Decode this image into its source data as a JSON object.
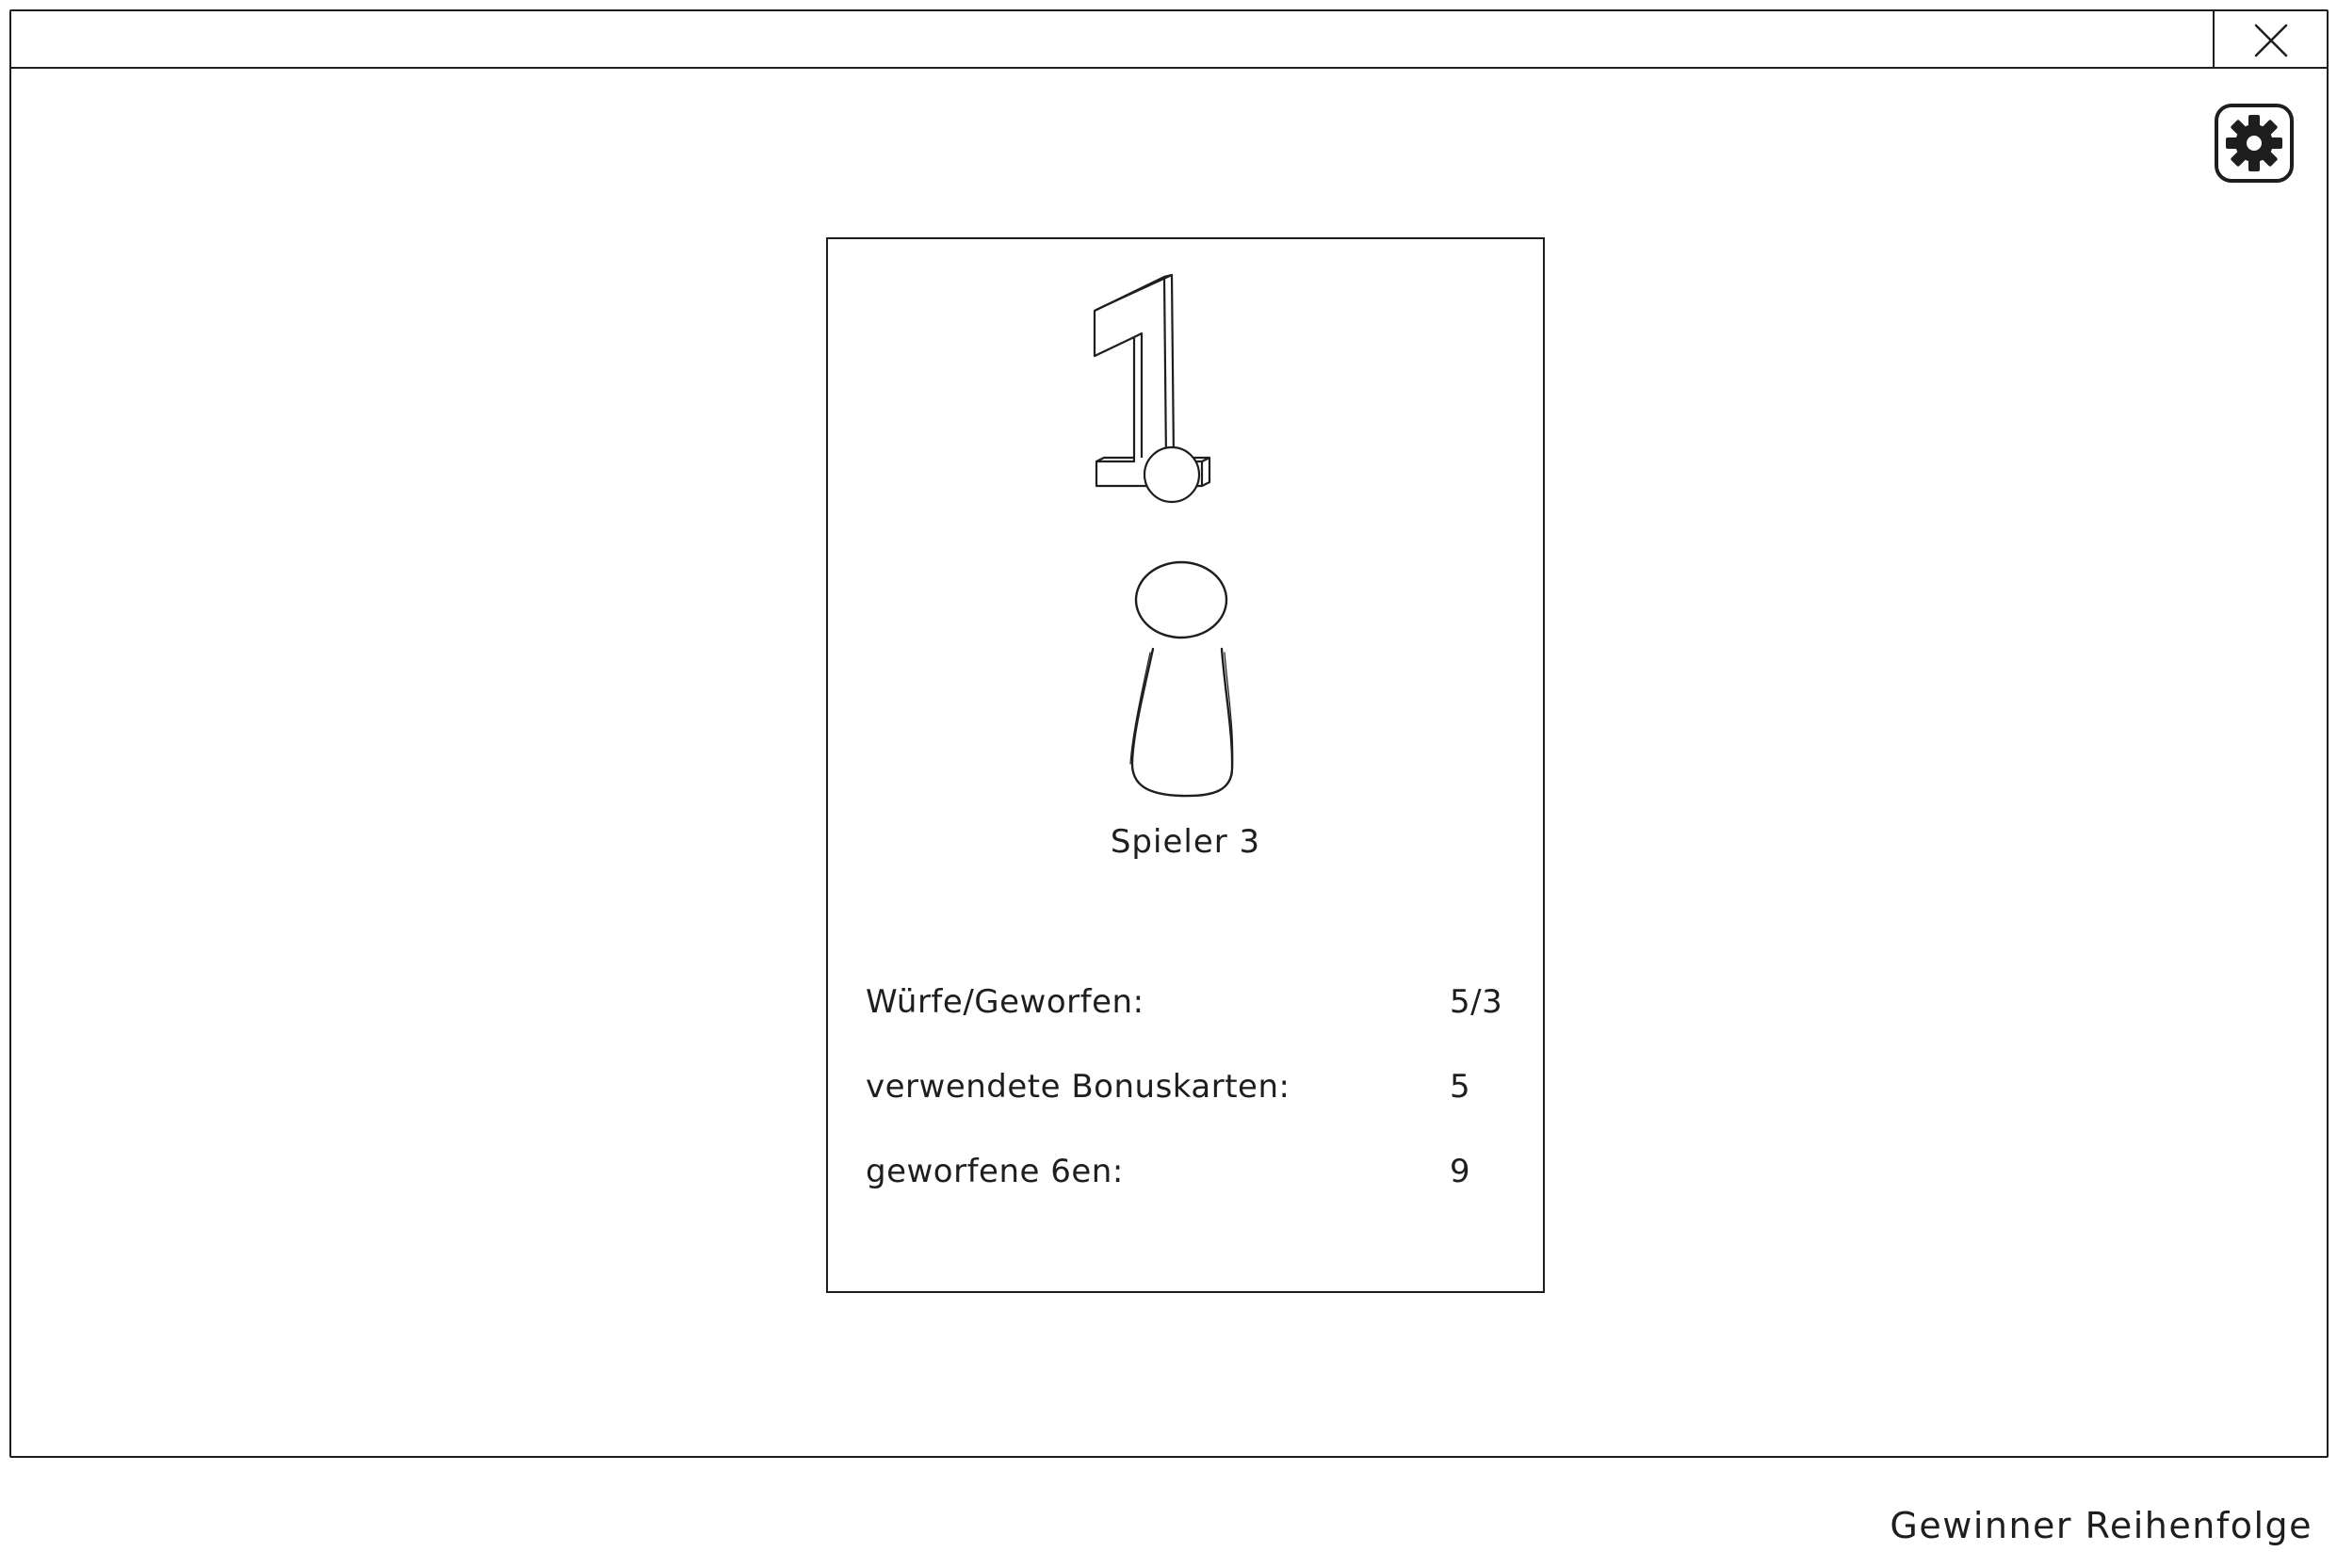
{
  "window": {
    "close_icon": "close-icon",
    "settings_icon": "gear-icon"
  },
  "winner_card": {
    "rank": "1.",
    "player_icon": "pawn-icon",
    "player_name": "Spieler 3",
    "stats": [
      {
        "label": "Würfe/Geworfen:",
        "value": "5/3"
      },
      {
        "label": "verwendete Bonuskarten:",
        "value": "5"
      },
      {
        "label": "geworfene 6en:",
        "value": "9"
      }
    ]
  },
  "caption": "Gewinner Reihenfolge"
}
